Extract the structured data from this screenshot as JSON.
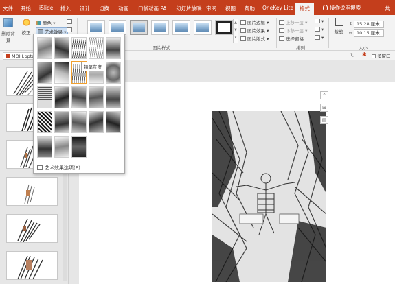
{
  "tabs": [
    "文件",
    "开始",
    "iSlide",
    "插入",
    "设计",
    "切换",
    "动画",
    "口袋动画 PA",
    "幻灯片放映",
    "审阅",
    "视图",
    "帮助",
    "OneKey Lite",
    "格式"
  ],
  "active_tab": "格式",
  "tell_me": "操作说明搜索",
  "share_label": "共",
  "ribbon": {
    "remove_bg": "删除背景",
    "correct": "校正",
    "color": "颜色",
    "artistic_effects": "艺术效果",
    "picture_styles_label": "图片样式",
    "picture_border": "图片边框",
    "picture_effects": "图片效果",
    "picture_layout": "图片版式",
    "bring_forward": "上移一层",
    "send_backward": "下移一层",
    "selection_pane": "选择窗格",
    "arrange_label": "排列",
    "crop": "裁剪",
    "height": "15.28 厘米",
    "width": "10.15 厘米",
    "size_label": "大小"
  },
  "subbar": {
    "file_name": "MOIII.pptx",
    "right_label": "多窗口"
  },
  "dropdown": {
    "tooltip": "铅笔灰度",
    "footer": "艺术效果选项(E)..."
  },
  "colors": {
    "accent": "#c43e1c",
    "ribbon_bg": "#f3f3f3",
    "app_bg": "#e6e6e6",
    "selection": "#f0a030"
  }
}
